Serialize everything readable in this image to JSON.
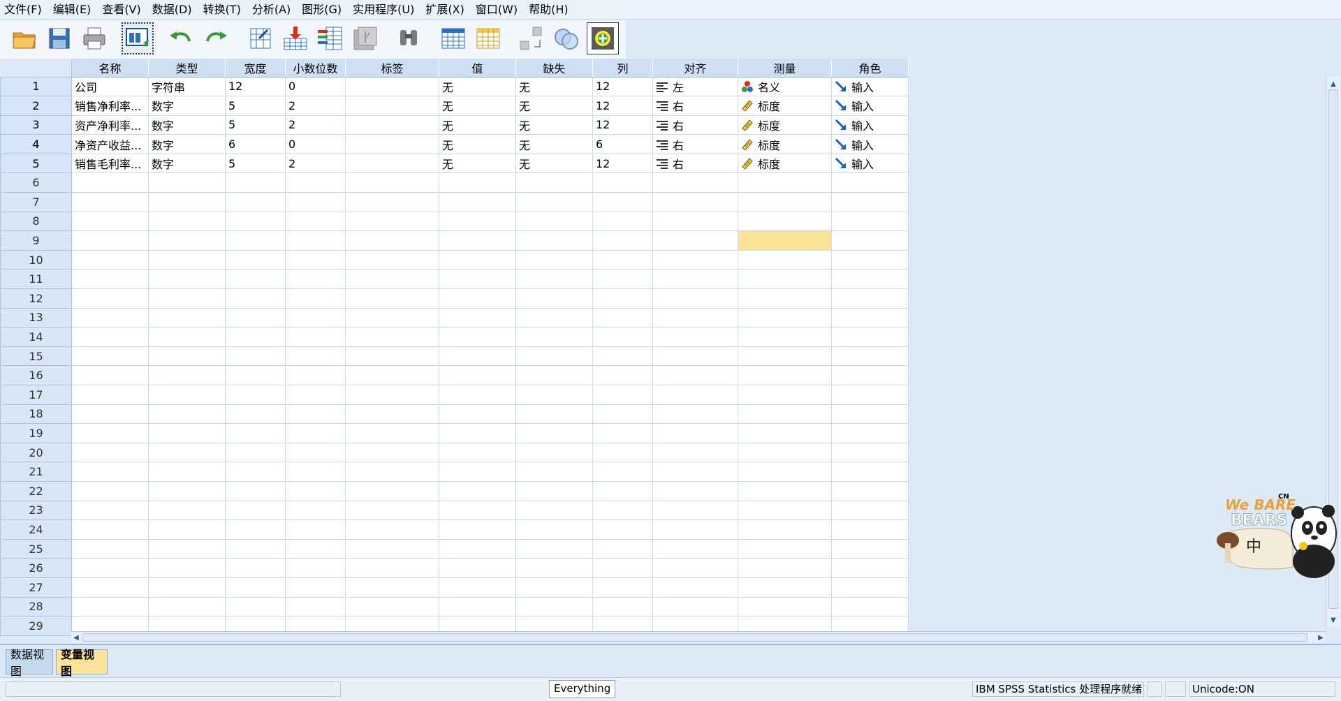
{
  "menu": [
    "文件(F)",
    "编辑(E)",
    "查看(V)",
    "数据(D)",
    "转换(T)",
    "分析(A)",
    "图形(G)",
    "实用程序(U)",
    "扩展(X)",
    "窗口(W)",
    "帮助(H)"
  ],
  "toolbar": {
    "buttons": [
      {
        "name": "open-file-icon"
      },
      {
        "name": "save-icon"
      },
      {
        "name": "print-icon"
      },
      {
        "name": "recall-dialog-icon"
      },
      {
        "name": "undo-icon"
      },
      {
        "name": "redo-icon"
      },
      {
        "name": "goto-case-icon"
      },
      {
        "name": "goto-variable-icon"
      },
      {
        "name": "variables-icon"
      },
      {
        "name": "run-descriptives-icon"
      },
      {
        "name": "find-icon"
      },
      {
        "name": "insert-cases-icon"
      },
      {
        "name": "insert-variable-icon"
      },
      {
        "name": "split-file-icon"
      },
      {
        "name": "weight-cases-icon"
      },
      {
        "name": "add-extension-icon"
      }
    ]
  },
  "grid": {
    "columns": [
      "名称",
      "类型",
      "宽度",
      "小数位数",
      "标签",
      "值",
      "缺失",
      "列",
      "对齐",
      "测量",
      "角色"
    ],
    "rows": [
      {
        "num": "1",
        "name": "公司",
        "type": "字符串",
        "width": "12",
        "decimals": "0",
        "label": "",
        "values": "无",
        "missing": "无",
        "columns": "12",
        "align": "左",
        "align_icon": "align-left-icon",
        "measure": "名义",
        "measure_icon": "nominal-icon",
        "role": "输入",
        "role_icon": "input-role-icon"
      },
      {
        "num": "2",
        "name": "销售净利率...",
        "type": "数字",
        "width": "5",
        "decimals": "2",
        "label": "",
        "values": "无",
        "missing": "无",
        "columns": "12",
        "align": "右",
        "align_icon": "align-right-icon",
        "measure": "标度",
        "measure_icon": "scale-icon",
        "role": "输入",
        "role_icon": "input-role-icon"
      },
      {
        "num": "3",
        "name": "资产净利率...",
        "type": "数字",
        "width": "5",
        "decimals": "2",
        "label": "",
        "values": "无",
        "missing": "无",
        "columns": "12",
        "align": "右",
        "align_icon": "align-right-icon",
        "measure": "标度",
        "measure_icon": "scale-icon",
        "role": "输入",
        "role_icon": "input-role-icon"
      },
      {
        "num": "4",
        "name": "净资产收益...",
        "type": "数字",
        "width": "6",
        "decimals": "0",
        "label": "",
        "values": "无",
        "missing": "无",
        "columns": "6",
        "align": "右",
        "align_icon": "align-right-icon",
        "measure": "标度",
        "measure_icon": "scale-icon",
        "role": "输入",
        "role_icon": "input-role-icon"
      },
      {
        "num": "5",
        "name": "销售毛利率...",
        "type": "数字",
        "width": "5",
        "decimals": "2",
        "label": "",
        "values": "无",
        "missing": "无",
        "columns": "12",
        "align": "右",
        "align_icon": "align-right-icon",
        "measure": "标度",
        "measure_icon": "scale-icon",
        "role": "输入",
        "role_icon": "input-role-icon"
      }
    ],
    "empty_row_numbers": [
      "6",
      "7",
      "8",
      "9",
      "10",
      "11",
      "12",
      "13",
      "14",
      "15",
      "16",
      "17",
      "18",
      "19",
      "20",
      "21",
      "22",
      "23",
      "24",
      "25",
      "26",
      "27",
      "28",
      "29"
    ],
    "selected_cell": {
      "row": "9",
      "column": "测量"
    }
  },
  "tabs": {
    "data_view": "数据视图",
    "variable_view": "变量视图",
    "active": "变量视图"
  },
  "status": {
    "tooltip": "Everything",
    "processor": "IBM SPSS Statistics 处理程序就绪",
    "unicode": "Unicode:ON"
  },
  "sticker": {
    "text_line1": "We BARE",
    "text_line2": "BEARS",
    "brand": "CN",
    "ime_label": "中"
  },
  "colors": {
    "selected_cell": "#fde39a",
    "active_tab": "#fde39a",
    "header_bg": "#cfe0f3"
  }
}
